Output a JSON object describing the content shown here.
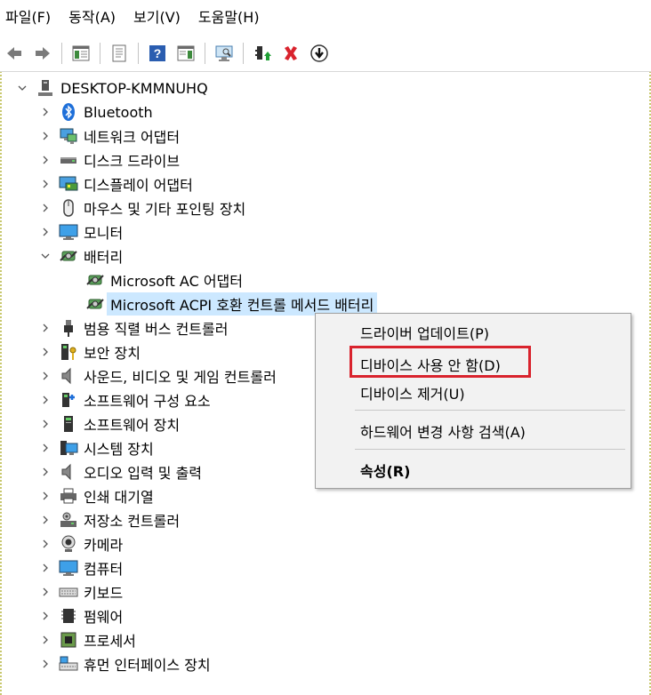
{
  "menubar": [
    {
      "label": "파일(F)"
    },
    {
      "label": "동작(A)"
    },
    {
      "label": "보기(V)"
    },
    {
      "label": "도움말(H)"
    }
  ],
  "toolbar": {
    "icons": [
      "back-arrow-icon",
      "forward-arrow-icon",
      "console-tree-icon",
      "properties-icon",
      "help-icon",
      "action-pane-icon",
      "scan-hardware-icon",
      "update-driver-icon",
      "uninstall-x-icon",
      "disable-device-icon"
    ],
    "uninstall_color": "#d9232d"
  },
  "tree": {
    "root": "DESKTOP-KMMNUHQ",
    "items": [
      {
        "label": "Bluetooth"
      },
      {
        "label": "네트워크 어댑터"
      },
      {
        "label": "디스크 드라이브"
      },
      {
        "label": "디스플레이 어댑터"
      },
      {
        "label": "마우스 및 기타 포인팅 장치"
      },
      {
        "label": "모니터"
      },
      {
        "label": "배터리"
      },
      {
        "label": "Microsoft AC 어댑터"
      },
      {
        "label": "Microsoft ACPI 호환 컨트롤 메서드 배터리"
      },
      {
        "label": "범용 직렬 버스 컨트롤러"
      },
      {
        "label": "보안 장치"
      },
      {
        "label": "사운드, 비디오 및 게임 컨트롤러"
      },
      {
        "label": "소프트웨어 구성 요소"
      },
      {
        "label": "소프트웨어 장치"
      },
      {
        "label": "시스템 장치"
      },
      {
        "label": "오디오 입력 및 출력"
      },
      {
        "label": "인쇄 대기열"
      },
      {
        "label": "저장소 컨트롤러"
      },
      {
        "label": "카메라"
      },
      {
        "label": "컴퓨터"
      },
      {
        "label": "키보드"
      },
      {
        "label": "펌웨어"
      },
      {
        "label": "프로세서"
      },
      {
        "label": "휴먼 인터페이스 장치"
      }
    ]
  },
  "context_menu": {
    "update_driver": "드라이버 업데이트(P)",
    "disable_device": "디바이스 사용 안 함(D)",
    "uninstall_device": "디바이스 제거(U)",
    "scan_hardware": "하드웨어 변경 사항 검색(A)",
    "properties": "속성(R)"
  },
  "colors": {
    "selection": "#cce8ff",
    "highlight_box": "#d9232d",
    "menu_bg": "#f2f2f2"
  }
}
